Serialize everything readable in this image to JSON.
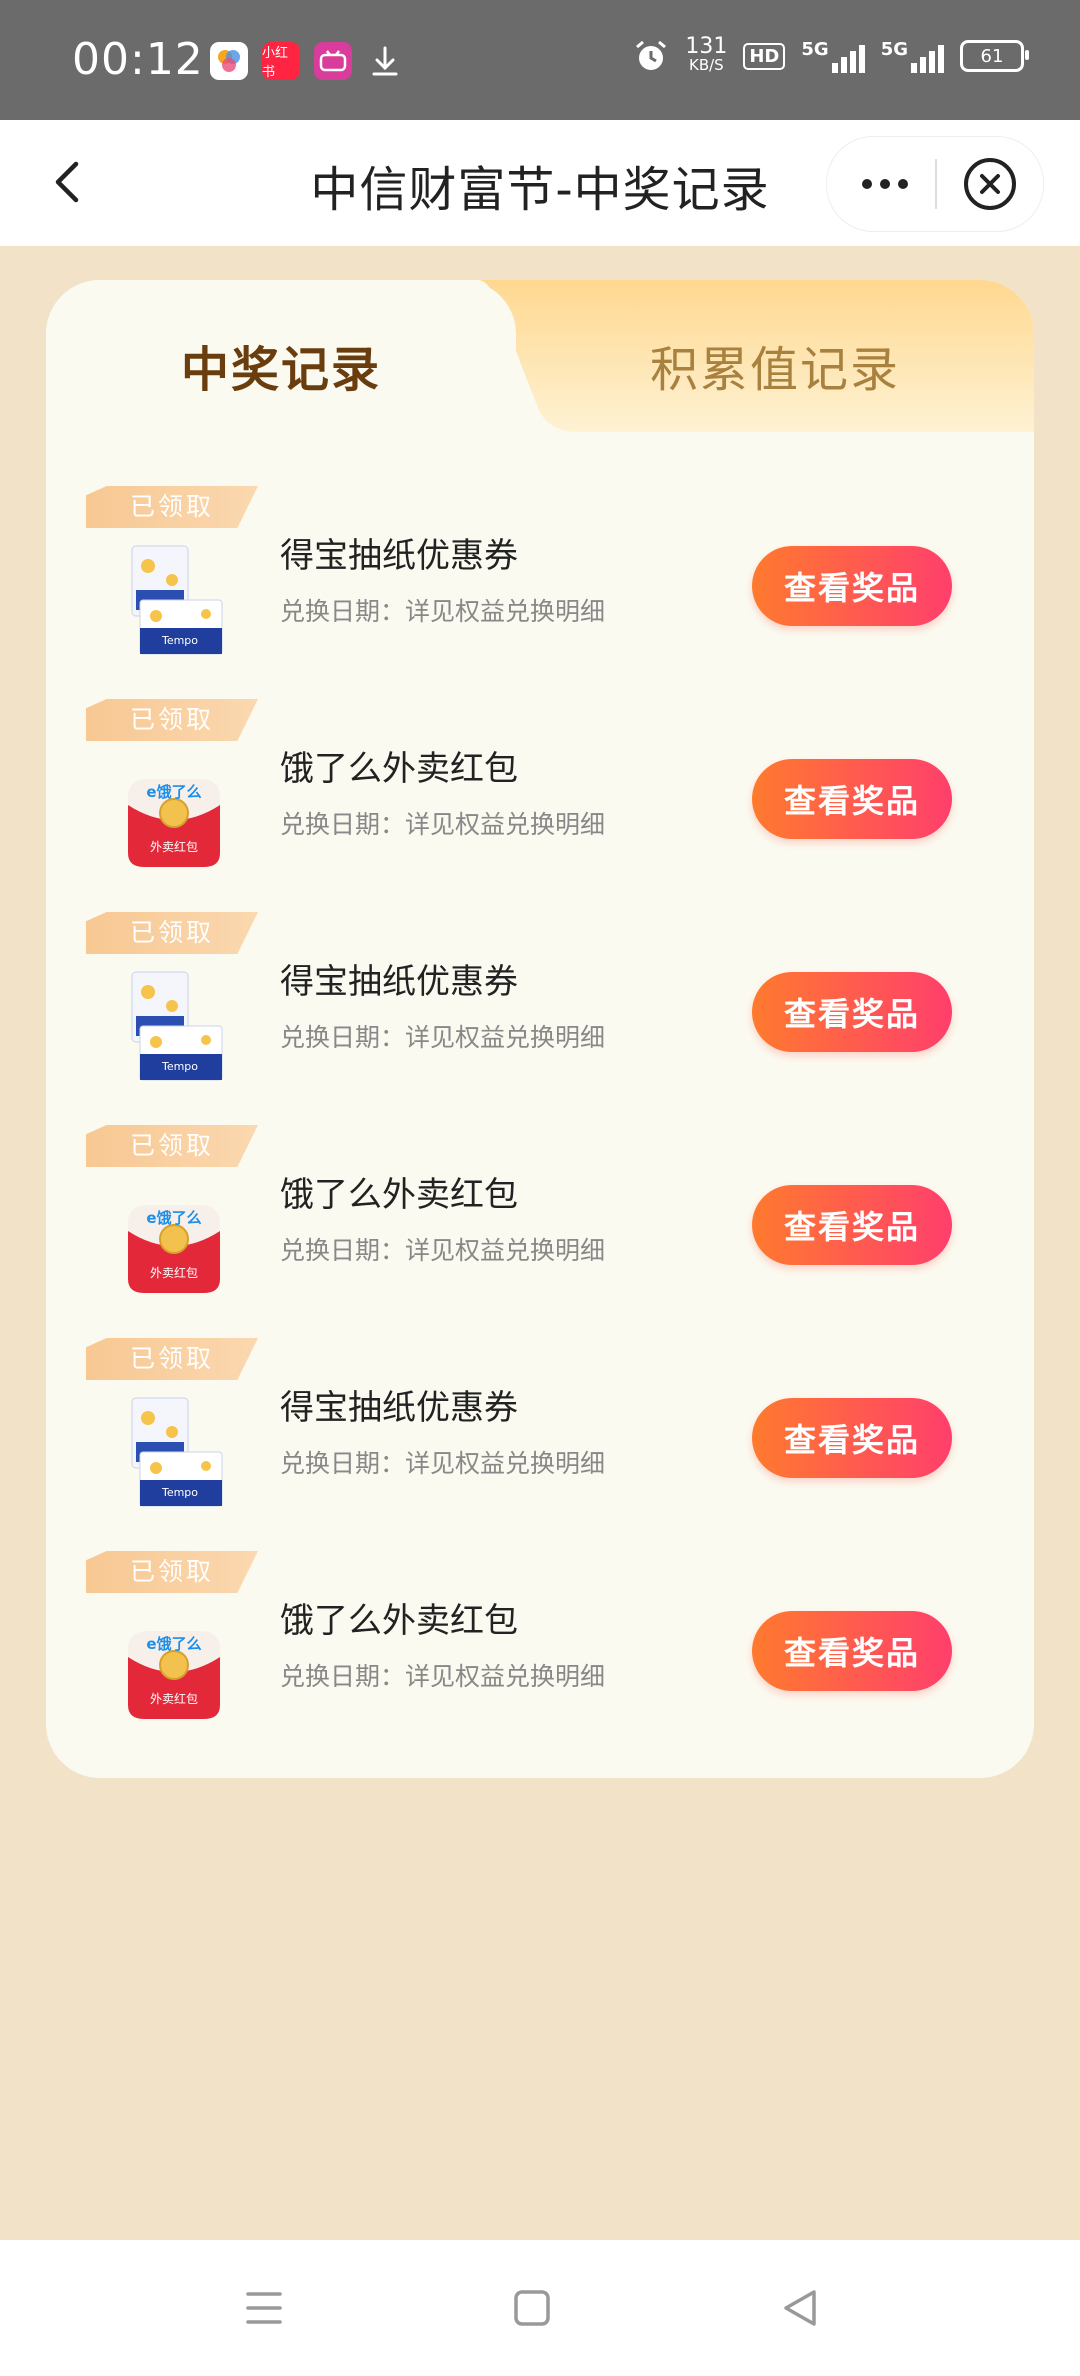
{
  "status_bar": {
    "time": "00:12",
    "app_icons": [
      "photos-icon",
      "xiaohongshu-icon",
      "bilibili-icon",
      "download-icon"
    ],
    "xiaohongshu_label": "小红书",
    "net_speed_value": "131",
    "net_speed_unit": "KB/S",
    "hd_label": "HD",
    "signal1_label": "5G",
    "signal2_label": "5G",
    "battery": "61"
  },
  "nav": {
    "title": "中信财富节-中奖记录"
  },
  "tabs": {
    "active": "中奖记录",
    "inactive": "积累值记录"
  },
  "records": [
    {
      "badge": "已领取",
      "name": "得宝抽纸优惠券",
      "date": "兑换日期：详见权益兑换明细",
      "button": "查看奖品",
      "image": "tissue"
    },
    {
      "badge": "已领取",
      "name": "饿了么外卖红包",
      "date": "兑换日期：详见权益兑换明细",
      "button": "查看奖品",
      "image": "eleme"
    },
    {
      "badge": "已领取",
      "name": "得宝抽纸优惠券",
      "date": "兑换日期：详见权益兑换明细",
      "button": "查看奖品",
      "image": "tissue"
    },
    {
      "badge": "已领取",
      "name": "饿了么外卖红包",
      "date": "兑换日期：详见权益兑换明细",
      "button": "查看奖品",
      "image": "eleme"
    },
    {
      "badge": "已领取",
      "name": "得宝抽纸优惠券",
      "date": "兑换日期：详见权益兑换明细",
      "button": "查看奖品",
      "image": "tissue"
    },
    {
      "badge": "已领取",
      "name": "饿了么外卖红包",
      "date": "兑换日期：详见权益兑换明细",
      "button": "查看奖品",
      "image": "eleme"
    }
  ],
  "eleme_logo_text": "e饿了么",
  "eleme_package_text": "外卖红包",
  "colors": {
    "page_bg": "#f2e3c8",
    "card_bg": "#fbfaf1",
    "button_start": "#ff7a2e",
    "button_end": "#ff3f6c",
    "badge": "#f7c892"
  }
}
